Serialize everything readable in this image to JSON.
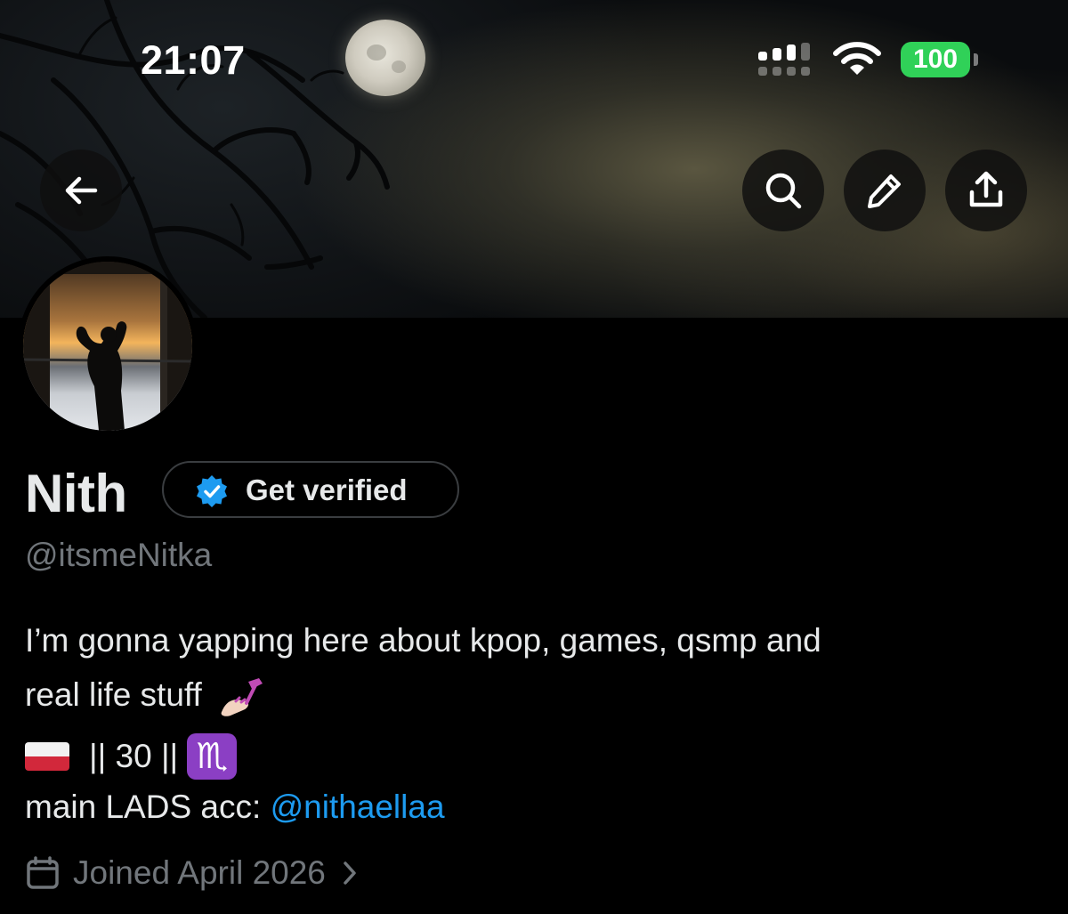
{
  "status_bar": {
    "time": "21:07",
    "battery": "100",
    "battery_color": "#30d158"
  },
  "nav": {
    "back_icon": "arrow-left-icon",
    "search_icon": "search-icon",
    "edit_icon": "pencil-icon",
    "share_icon": "share-icon"
  },
  "profile": {
    "display_name": "Nith",
    "verify_label": "Get verified",
    "verify_icon": "verified-badge-icon",
    "verify_color": "#1d9bf0",
    "handle": "@itsmeNitka",
    "bio": {
      "line1": "I’m gonna yapping here about kpop, games, qsmp and",
      "line2": "real life stuff",
      "line3_text": "|| 30 ||",
      "line3_zodiac": "♏",
      "line4_prefix": "main LADS acc: ",
      "line4_mention": "@nithaellaa"
    },
    "joined": "Joined April 2026"
  }
}
